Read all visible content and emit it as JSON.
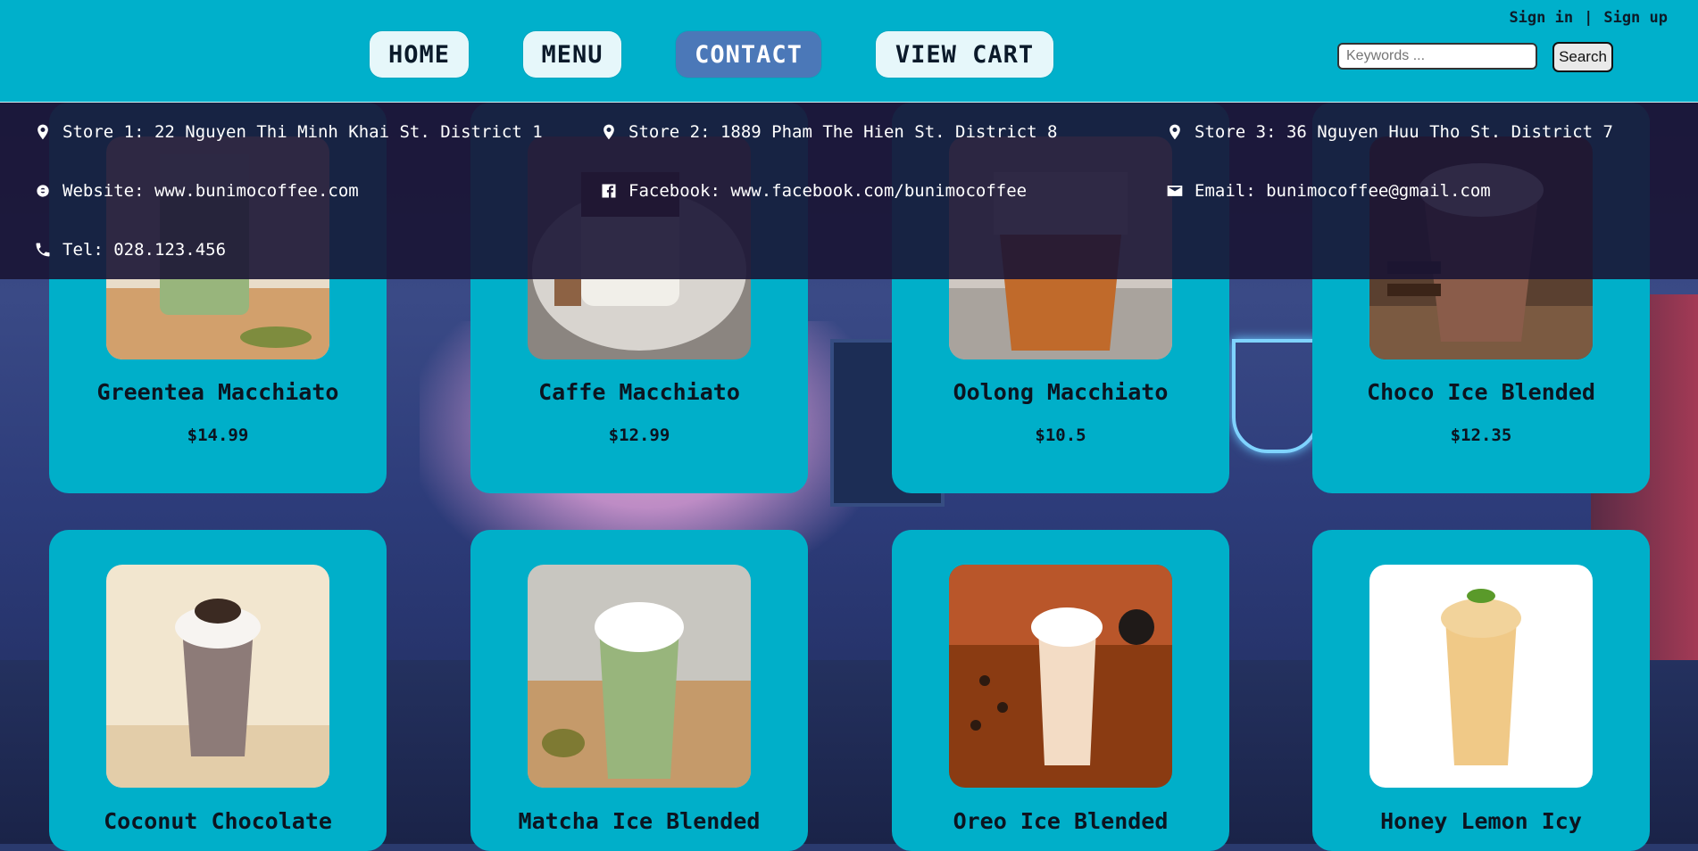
{
  "auth": {
    "signin": "Sign in",
    "divider": "|",
    "signup": "Sign up"
  },
  "nav": {
    "home": "HOME",
    "menu": "MENU",
    "contact": "CONTACT",
    "cart": "VIEW CART"
  },
  "search": {
    "placeholder": "Keywords ...",
    "button": "Search"
  },
  "contact": {
    "store1": "Store 1: 22 Nguyen Thi Minh Khai St. District 1",
    "store2": "Store 2: 1889 Pham The Hien St. District 8",
    "store3": "Store 3: 36 Nguyen Huu Tho St. District 7",
    "website": "Website: www.bunimocoffee.com",
    "facebook": "Facebook: www.facebook.com/bunimocoffee",
    "email": "Email: bunimocoffee@gmail.com",
    "tel": "Tel: 028.123.456"
  },
  "products": [
    {
      "name": "Greentea Macchiato",
      "price": "$14.99"
    },
    {
      "name": "Caffe Macchiato",
      "price": "$12.99"
    },
    {
      "name": "Oolong Macchiato",
      "price": "$10.5"
    },
    {
      "name": "Choco Ice Blended",
      "price": "$12.35"
    },
    {
      "name": "Coconut Chocolate"
    },
    {
      "name": "Matcha Ice Blended"
    },
    {
      "name": "Oreo Ice Blended"
    },
    {
      "name": "Honey Lemon Icy"
    }
  ]
}
